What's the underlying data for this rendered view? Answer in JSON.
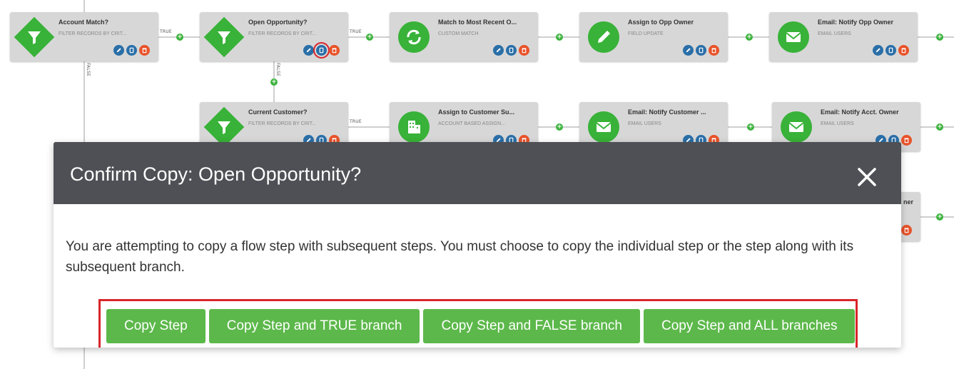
{
  "flow": {
    "nodes": [
      {
        "id": "account-match",
        "title": "Account Match?",
        "subtitle": "FILTER RECORDS BY CRIT...",
        "icon": "filter-icon"
      },
      {
        "id": "open-opportunity",
        "title": "Open Opportunity?",
        "subtitle": "FILTER RECORDS BY CRIT...",
        "icon": "filter-icon"
      },
      {
        "id": "match-recent",
        "title": "Match to Most Recent O...",
        "subtitle": "CUSTOM MATCH",
        "icon": "sync-icon"
      },
      {
        "id": "assign-opp-owner",
        "title": "Assign to Opp Owner",
        "subtitle": "FIELD UPDATE",
        "icon": "pencil-icon"
      },
      {
        "id": "email-opp-owner",
        "title": "Email: Notify Opp Owner",
        "subtitle": "EMAIL USERS",
        "icon": "mail-icon"
      },
      {
        "id": "current-customer",
        "title": "Current Customer?",
        "subtitle": "FILTER RECORDS BY CRIT...",
        "icon": "filter-icon"
      },
      {
        "id": "assign-customer",
        "title": "Assign to Customer Su...",
        "subtitle": "ACCOUNT BASED ASSIGN...",
        "icon": "building-icon"
      },
      {
        "id": "email-customer",
        "title": "Email: Notify Customer ...",
        "subtitle": "EMAIL USERS",
        "icon": "mail-icon"
      },
      {
        "id": "email-acct-owner",
        "title": "Email: Notify Acct. Owner",
        "subtitle": "EMAIL USERS",
        "icon": "mail-icon"
      }
    ],
    "partial_title": "ner",
    "edge_labels": {
      "true": "TRUE",
      "false": "FALSE"
    }
  },
  "modal": {
    "title": "Confirm Copy: Open Opportunity?",
    "message": "You are attempting to copy a flow step with subsequent steps. You must choose to copy the individual step or the step along with its subsequent branch.",
    "buttons": {
      "copy_step": "Copy Step",
      "copy_true": "Copy Step and TRUE branch",
      "copy_false": "Copy Step and FALSE branch",
      "copy_all": "Copy Step and ALL branches"
    }
  },
  "colors": {
    "accent_green": "#5cb84a",
    "header_bg": "#4f5055",
    "highlight_red": "#d9252b",
    "edit_blue": "#2a6fa8",
    "delete_orange": "#e8532a"
  }
}
